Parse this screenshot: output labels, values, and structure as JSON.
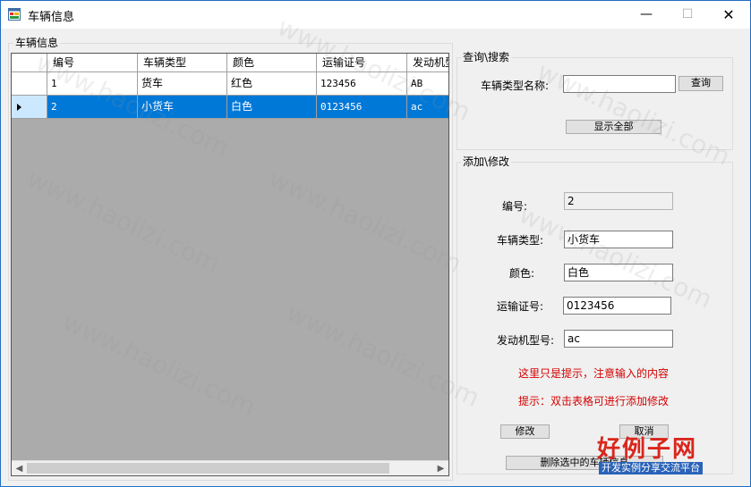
{
  "window": {
    "title": "车辆信息"
  },
  "titlebar": {
    "minimize": "—",
    "maximize": "☐",
    "close": "✕"
  },
  "vehicle_info_group": {
    "title": "车辆信息"
  },
  "grid": {
    "columns": [
      "编号",
      "车辆类型",
      "颜色",
      "运输证号",
      "发动机型号"
    ],
    "rows": [
      {
        "id": "1",
        "type": "货车",
        "color": "红色",
        "cert": "123456",
        "engine": "AB",
        "selected": false
      },
      {
        "id": "2",
        "type": "小货车",
        "color": "白色",
        "cert": "0123456",
        "engine": "ac",
        "selected": true
      }
    ],
    "scroll_left": "◀",
    "scroll_right": "▶"
  },
  "query_group": {
    "title": "查询\\搜索",
    "type_name_label": "车辆类型名称:",
    "type_name_value": "",
    "search_button": "查询",
    "show_all_button": "显示全部"
  },
  "edit_group": {
    "title": "添加\\修改",
    "id_label": "编号:",
    "id_value": "2",
    "type_label": "车辆类型:",
    "type_value": "小货车",
    "color_label": "颜色:",
    "color_value": "白色",
    "cert_label": "运输证号:",
    "cert_value": "0123456",
    "engine_label": "发动机型号:",
    "engine_value": "ac",
    "hint1": "这里只是提示，注意输入的内容",
    "hint2": "提示：双击表格可进行添加修改",
    "modify_button": "修改",
    "cancel_button": "取消",
    "delete_button": "删除选中的车辆信息"
  },
  "watermark": {
    "text": "www.haolizi.com"
  },
  "logo": {
    "main": "好例子网",
    "sub": "开发实例分享交流平台"
  },
  "colors": {
    "selection": "#0078d7",
    "hint": "#d40000",
    "title_border": "#1f6fbf"
  }
}
